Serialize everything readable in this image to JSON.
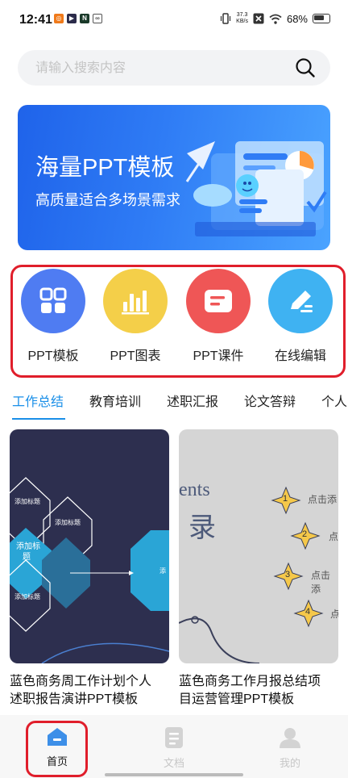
{
  "status_bar": {
    "time": "12:41",
    "net_speed_value": "37.3",
    "net_speed_unit": "KB/s",
    "battery": "68%",
    "app_badges": [
      {
        "icon": "app-orange-icon",
        "color": "#f07a1a"
      },
      {
        "icon": "app-play-icon",
        "color": "#2b2b4a"
      },
      {
        "icon": "app-n-icon",
        "color": "#1a3a2a"
      },
      {
        "icon": "app-link-icon",
        "color": "#555555"
      }
    ]
  },
  "search": {
    "placeholder": "请输入搜索内容"
  },
  "banner": {
    "title": "海量PPT模板",
    "subtitle": "高质量适合多场景需求"
  },
  "categories": [
    {
      "label": "PPT模板",
      "icon": "grid-icon",
      "color": "#4f7cf2"
    },
    {
      "label": "PPT图表",
      "icon": "bar-chart-icon",
      "color": "#f4cf49"
    },
    {
      "label": "PPT课件",
      "icon": "courseware-icon",
      "color": "#ef5656"
    },
    {
      "label": "在线编辑",
      "icon": "edit-pen-icon",
      "color": "#3fb2f2"
    }
  ],
  "tabs": [
    {
      "label": "工作总结",
      "active": true
    },
    {
      "label": "教育培训",
      "active": false
    },
    {
      "label": "述职汇报",
      "active": false
    },
    {
      "label": "论文答辩",
      "active": false
    },
    {
      "label": "个人",
      "active": false
    }
  ],
  "cards": [
    {
      "title_line1": "蓝色商务周工作计划个人",
      "title_line2": "述职报告演讲PPT模板",
      "thumb": {
        "hex_labels": [
          "添加标题",
          "添加标题",
          "添加标",
          "题",
          "添加标题",
          "添"
        ]
      }
    },
    {
      "title_line1": "蓝色商务工作月报总结项",
      "title_line2": "目运营管理PPT模板",
      "thumb": {
        "heading_en": "ents",
        "heading_cn": "录",
        "numbers": [
          "1",
          "2",
          "3",
          "4"
        ],
        "items": [
          "点击添",
          "点",
          "点击添",
          "点"
        ]
      }
    }
  ],
  "bottom_nav": [
    {
      "label": "首页",
      "icon": "home-icon",
      "active": true
    },
    {
      "label": "文档",
      "icon": "document-icon",
      "active": false
    },
    {
      "label": "我的",
      "icon": "profile-icon",
      "active": false
    }
  ],
  "colors": {
    "accent": "#1a8fe8",
    "highlight_border": "#e01e2b",
    "banner_blue": "#2f7cf5"
  }
}
